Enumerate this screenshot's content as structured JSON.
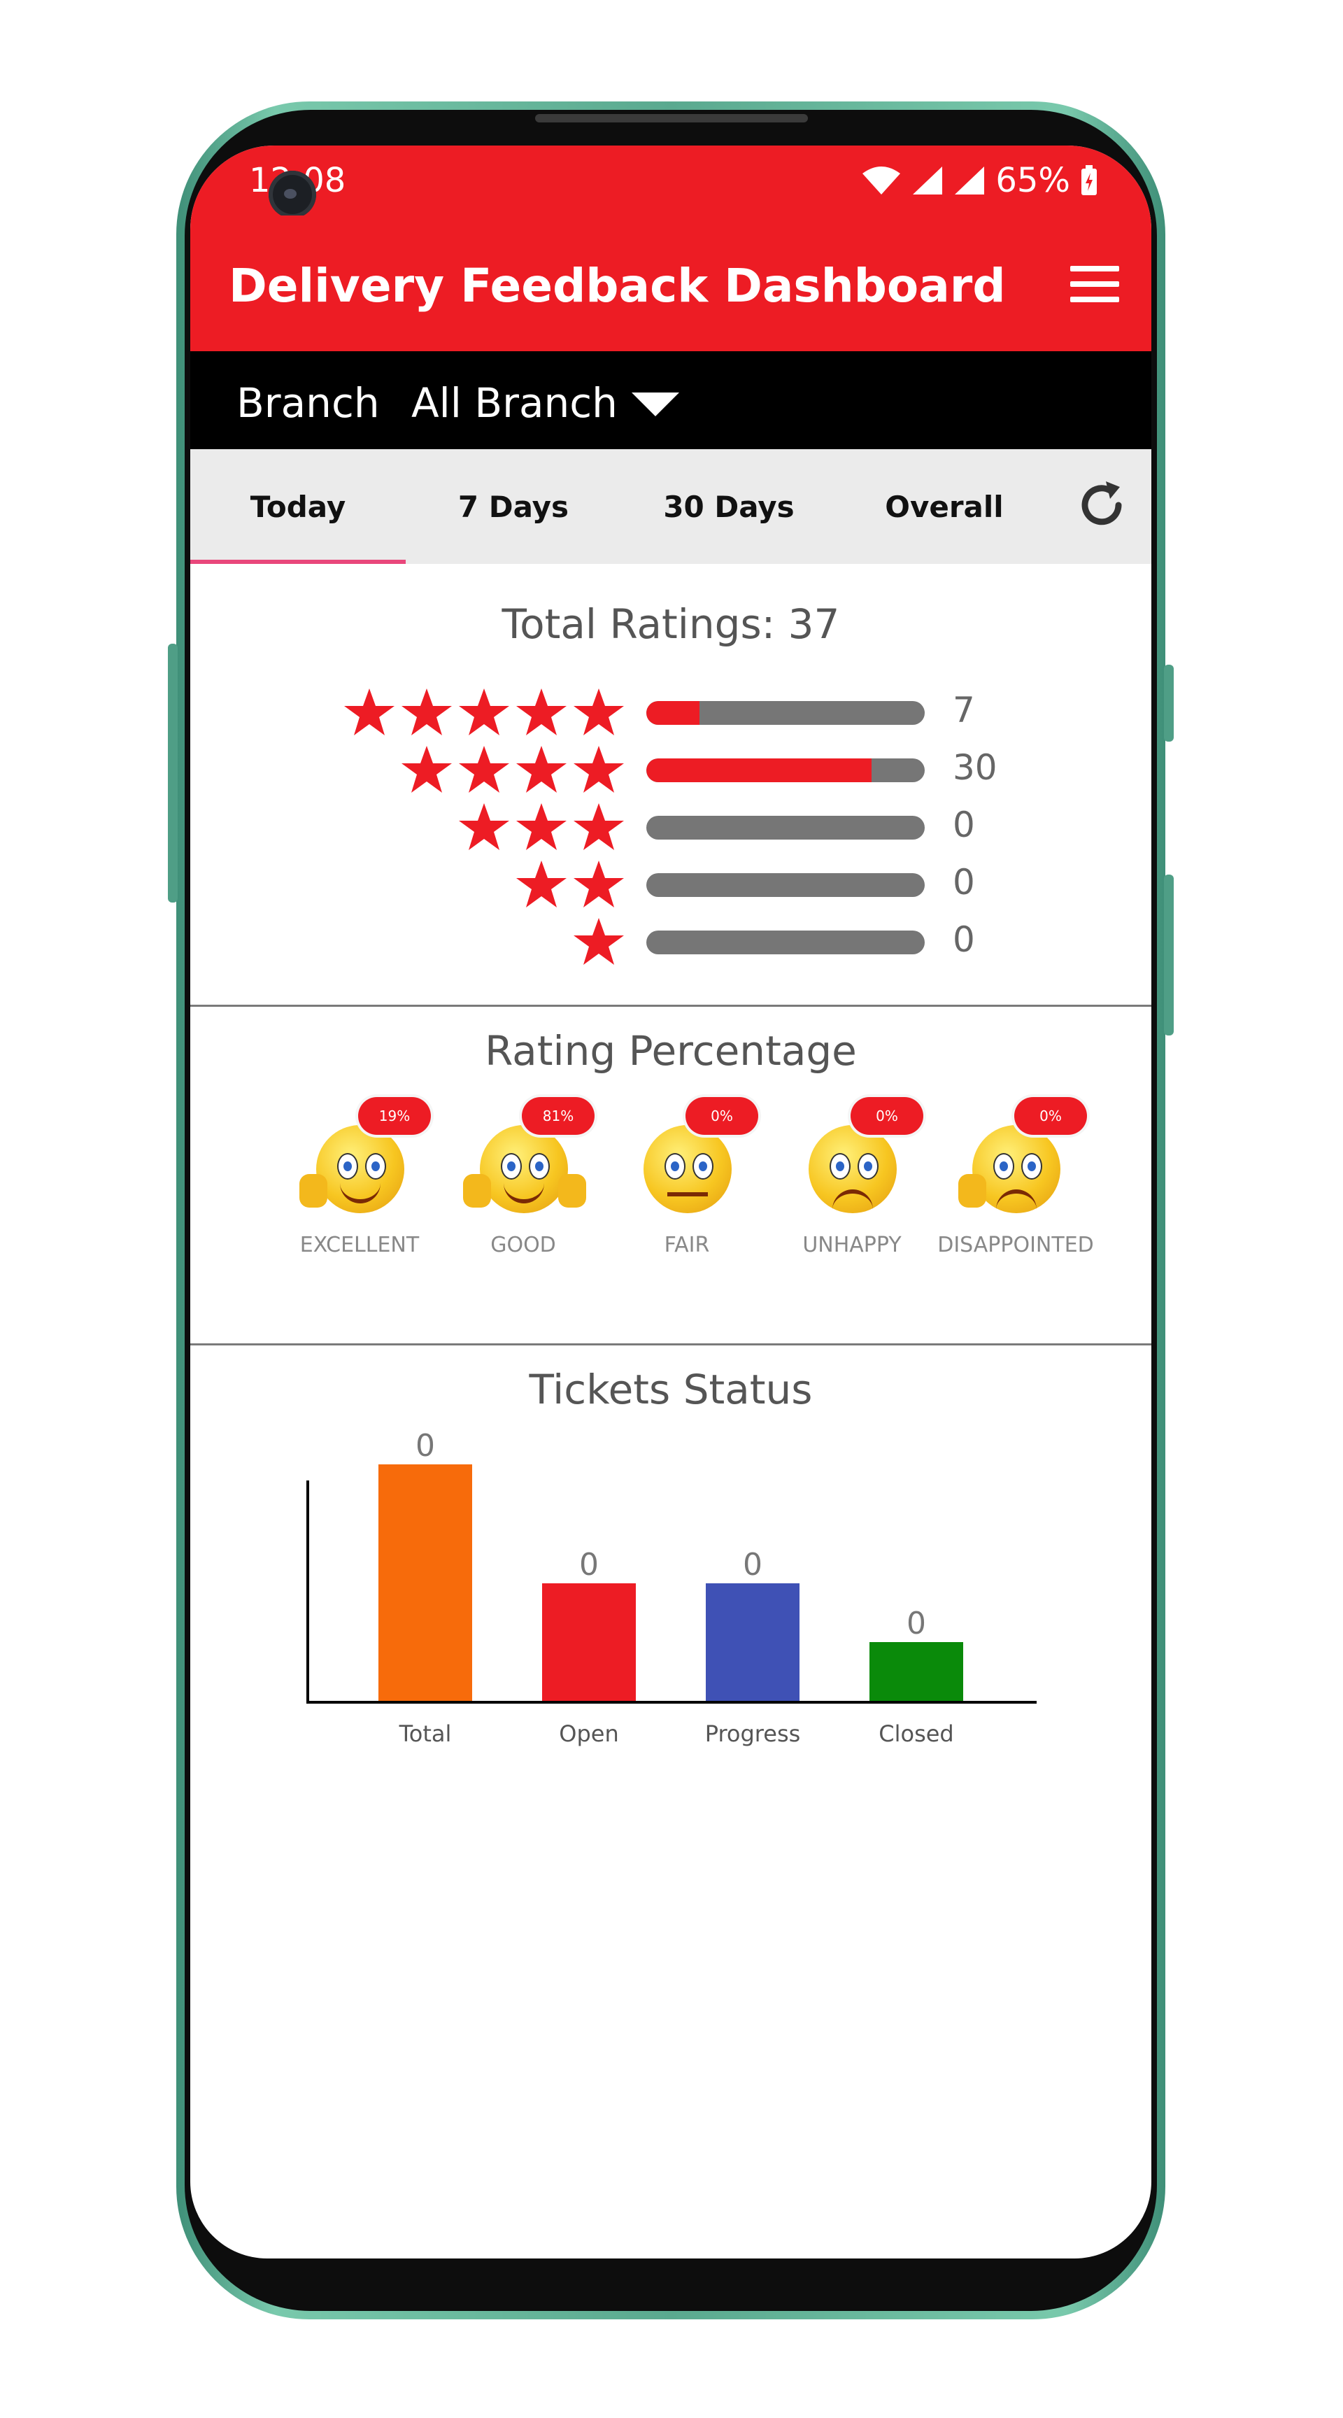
{
  "status": {
    "time": "12:08",
    "battery": "65%"
  },
  "app": {
    "title": "Delivery Feedback Dashboard",
    "menu_icon": "hamburger-menu-icon"
  },
  "branch": {
    "label": "Branch",
    "selected": "All Branch"
  },
  "tabs": [
    {
      "label": "Today",
      "active": true
    },
    {
      "label": "7 Days",
      "active": false
    },
    {
      "label": "30 Days",
      "active": false
    },
    {
      "label": "Overall",
      "active": false
    }
  ],
  "ratings": {
    "title": "Total Ratings: 37",
    "rows": [
      {
        "stars": 5,
        "count": "7",
        "fraction": 0.19
      },
      {
        "stars": 4,
        "count": "30",
        "fraction": 0.81
      },
      {
        "stars": 3,
        "count": "0",
        "fraction": 0
      },
      {
        "stars": 2,
        "count": "0",
        "fraction": 0
      },
      {
        "stars": 1,
        "count": "0",
        "fraction": 0
      }
    ]
  },
  "rating_percentage": {
    "title": "Rating Percentage",
    "items": [
      {
        "label": "EXCELLENT",
        "percent": "19%",
        "mood": "happy"
      },
      {
        "label": "GOOD",
        "percent": "81%",
        "mood": "happy"
      },
      {
        "label": "FAIR",
        "percent": "0%",
        "mood": "flat"
      },
      {
        "label": "UNHAPPY",
        "percent": "0%",
        "mood": "sad"
      },
      {
        "label": "DISAPPOINTED",
        "percent": "0%",
        "mood": "sad"
      }
    ]
  },
  "tickets": {
    "title": "Tickets Status"
  },
  "chart_data": {
    "type": "bar",
    "title": "Tickets Status",
    "categories": [
      "Total",
      "Open",
      "Progress",
      "Closed"
    ],
    "values": [
      0,
      0,
      0,
      0
    ],
    "data_labels": [
      "0",
      "0",
      "0",
      "0"
    ],
    "colors": [
      "#f76b0b",
      "#ed1c24",
      "#3f51b5",
      "#0a8a0a"
    ],
    "xlabel": "",
    "ylabel": ""
  },
  "colors": {
    "brand_red": "#ed1c24",
    "tab_indicator": "#e9477b",
    "track_gray": "#767676"
  }
}
